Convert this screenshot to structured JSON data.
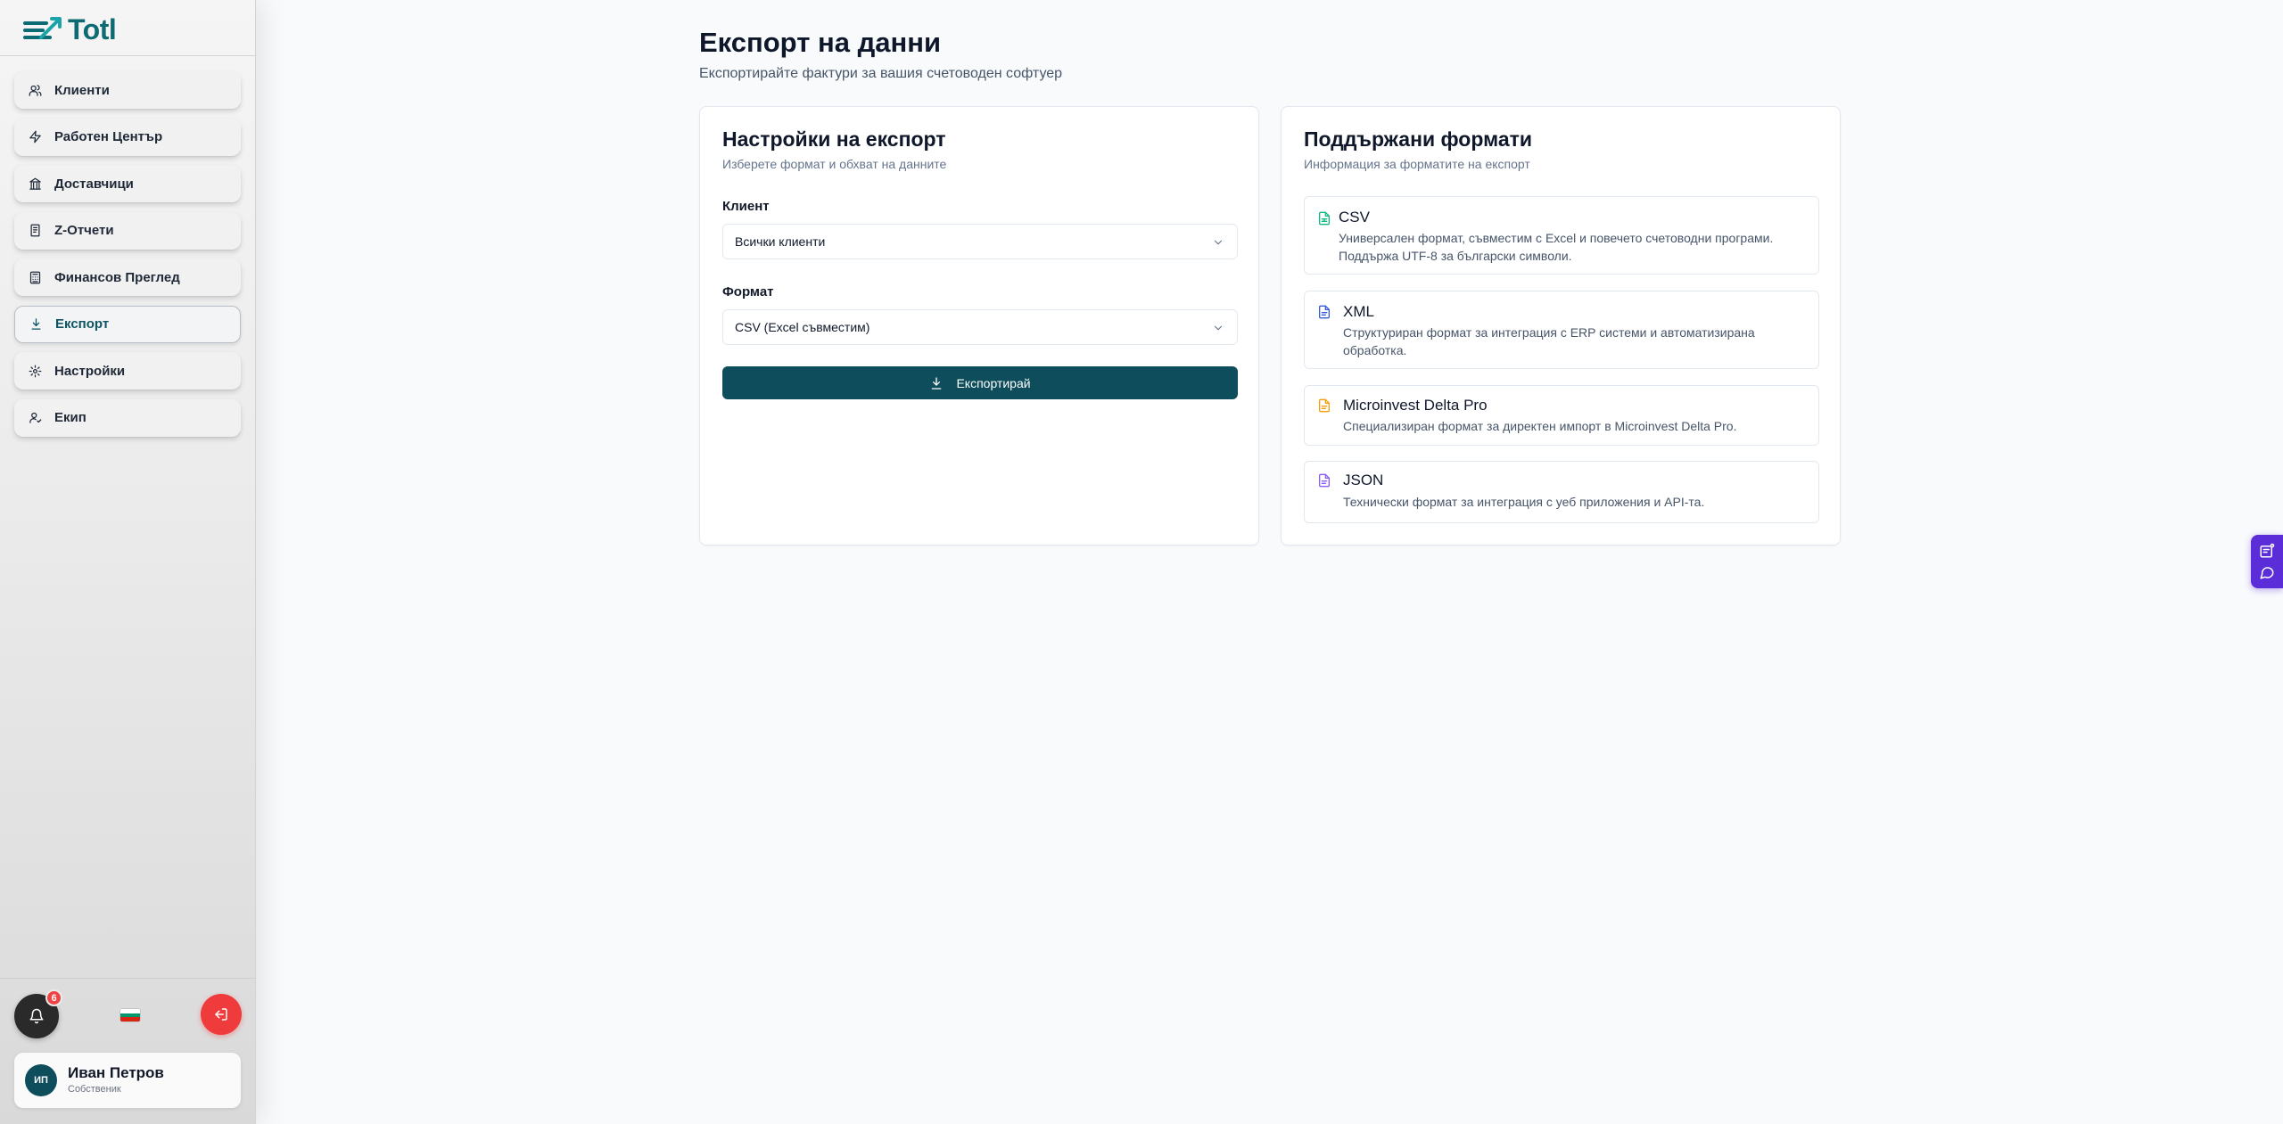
{
  "app": {
    "name": "Totl"
  },
  "sidebar": {
    "items": [
      {
        "label": "Клиенти",
        "icon": "users-icon"
      },
      {
        "label": "Работен Център",
        "icon": "zap-icon"
      },
      {
        "label": "Доставчици",
        "icon": "bank-icon"
      },
      {
        "label": "Z-Отчети",
        "icon": "receipt-icon"
      },
      {
        "label": "Финансов Преглед",
        "icon": "calculator-icon"
      },
      {
        "label": "Експорт",
        "icon": "download-icon",
        "active": true
      },
      {
        "label": "Настройки",
        "icon": "gear-icon"
      },
      {
        "label": "Екип",
        "icon": "team-icon"
      }
    ],
    "notifications_count": "6",
    "language_flag": "bulgarian-flag",
    "user": {
      "initials": "ИП",
      "name": "Иван Петров",
      "role": "Собственик"
    }
  },
  "page": {
    "title": "Експорт на данни",
    "subtitle": "Експортирайте фактури за вашия счетоводен софтуер"
  },
  "settings_card": {
    "title": "Настройки на експорт",
    "description": "Изберете формат и обхват на данните",
    "client_label": "Клиент",
    "client_value": "Всички клиенти",
    "format_label": "Формат",
    "format_value": "CSV (Excel съвместим)",
    "export_button": "Експортирай"
  },
  "formats_card": {
    "title": "Поддържани формати",
    "description": "Информация за форматите на експорт",
    "formats": [
      {
        "name": "CSV",
        "description": "Универсален формат, съвместим с Excel и повечето счетоводни програми. Поддържа UTF-8 за български символи.",
        "color": "#10b981"
      },
      {
        "name": "XML",
        "description": "Структуриран формат за интеграция с ERP системи и автоматизирана обработка.",
        "color": "#3b5bdb"
      },
      {
        "name": "Microinvest Delta Pro",
        "description": "Специализиран формат за директен импорт в Microinvest Delta Pro.",
        "color": "#f59e0b"
      },
      {
        "name": "JSON",
        "description": "Технически формат за интеграция с уеб приложения и API-та.",
        "color": "#8b5cf6"
      }
    ]
  },
  "colors": {
    "primary": "#0d4d5c",
    "brand": "#0e6b73",
    "danger": "#ef3b3b",
    "widget": "#5b2dd9"
  }
}
